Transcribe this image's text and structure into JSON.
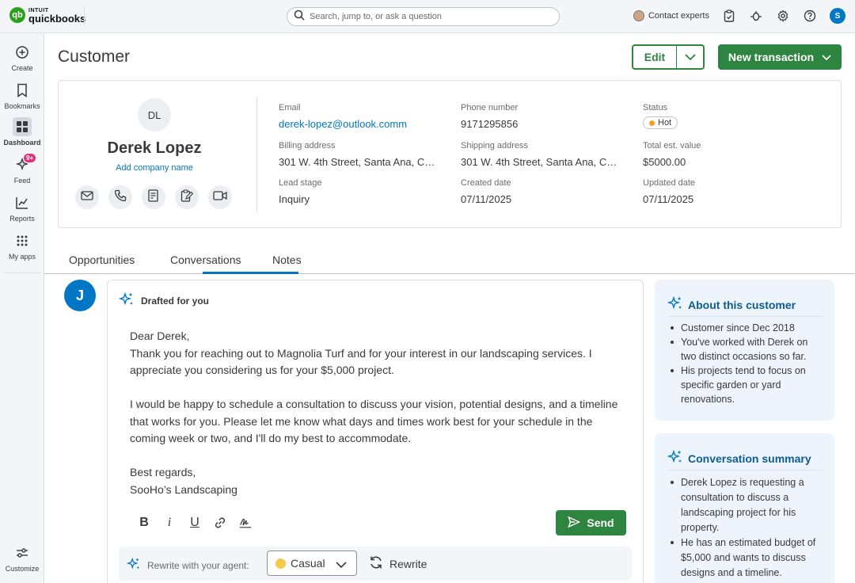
{
  "topbar": {
    "logo_brand": "INTUIT",
    "logo_product": "quickbooks",
    "logo_mark": "qb",
    "search_placeholder": "Search, jump to, or ask a question",
    "contact_label": "Contact experts",
    "user_initial": "S",
    "icons": [
      "search-icon",
      "clipboard-icon",
      "bug-icon",
      "gear-icon",
      "help-icon"
    ]
  },
  "nav": {
    "items": [
      {
        "label": "Create",
        "icon": "plus-circle-icon"
      },
      {
        "label": "Bookmarks",
        "icon": "bookmark-icon"
      },
      {
        "label": "Dashboard",
        "icon": "dashboard-icon",
        "active": true
      },
      {
        "label": "Feed",
        "icon": "sparkle-icon",
        "badge": "9+"
      },
      {
        "label": "Reports",
        "icon": "chart-icon"
      },
      {
        "label": "My apps",
        "icon": "apps-grid-icon"
      }
    ],
    "customize": "Customize"
  },
  "header": {
    "title": "Customer",
    "edit_label": "Edit",
    "new_transaction_label": "New transaction"
  },
  "customer": {
    "initials": "DL",
    "name": "Derek Lopez",
    "add_company": "Add company name",
    "actions": [
      "mail-icon",
      "phone-icon",
      "invoice-icon",
      "clipboard-edit-icon",
      "video-icon"
    ],
    "fields": {
      "email_label": "Email",
      "email": "derek-lopez@outlook.comm",
      "phone_label": "Phone number",
      "phone": "9171295856",
      "status_label": "Status",
      "status": "Hot",
      "billing_label": "Billing address",
      "billing": "301 W. 4th Street, Santa Ana, Ca...",
      "shipping_label": "Shipping address",
      "shipping": "301 W. 4th Street, Santa Ana, Ca...",
      "total_label": "Total est. value",
      "total": "$5000.00",
      "lead_label": "Lead stage",
      "lead": "Inquiry",
      "created_label": "Created date",
      "created": "07/11/2025",
      "updated_label": "Updated date",
      "updated": "07/11/2025"
    }
  },
  "tabs": [
    {
      "label": "Opportunities"
    },
    {
      "label": "Conversations",
      "active": true
    },
    {
      "label": "Notes"
    }
  ],
  "conversation": {
    "avatar_initial": "J",
    "draft_header": "Drafted for you",
    "greeting": "Dear Derek,",
    "p1": "Thank you for reaching out to Magnolia Turf and for your interest in our landscaping services. I appreciate you considering us for your $5,000 project.",
    "p2": "I would be happy to schedule a consultation to discuss your vision, potential designs, and a timeline that works for you. Please let me know what days and times work best for your schedule in the coming week or two, and I'll do my best to accommodate.",
    "signoff": "Best regards,",
    "signature": "SooHo’s Landscaping",
    "format_tools": {
      "bold": "B",
      "italic": "i",
      "underline": "U"
    },
    "send_label": "Send",
    "rewrite_label": "Rewrite with your agent:",
    "tone": "Casual",
    "rewrite_button": "Rewrite"
  },
  "about": {
    "title": "About this customer",
    "items": [
      "Customer since Dec 2018",
      "You've worked with Derek on two distinct occasions so far.",
      "His projects tend to focus on specific garden or yard renovations."
    ]
  },
  "summary": {
    "title": "Conversation summary",
    "items": [
      "Derek Lopez is requesting a consultation to discuss a landscaping project for his property.",
      "He has an estimated budget of $5,000 and wants to discuss designs and a timeline."
    ]
  },
  "colors": {
    "brand_green": "#2e8540",
    "link_blue": "#0077c5",
    "panel_bg": "#eef4fb",
    "status_hot": "#f6a124"
  }
}
